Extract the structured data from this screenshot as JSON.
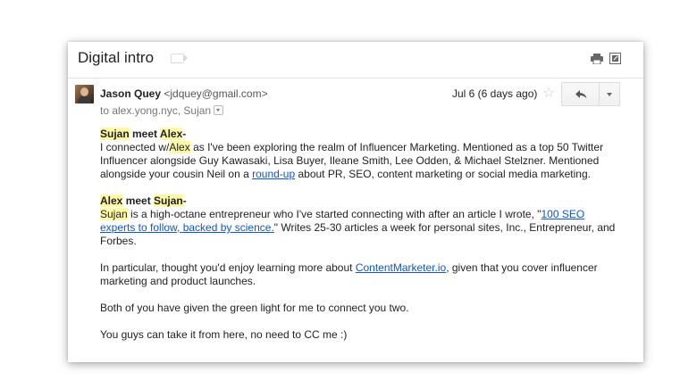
{
  "email": {
    "subject": "Digital intro",
    "sender_name": "Jason Quey",
    "sender_email": "<jdquey@gmail.com>",
    "to_line": "to alex.yong.nyc, Sujan",
    "date": "Jul 6 (6 days ago)",
    "icons": [
      "label-icon",
      "print-icon",
      "popout-icon",
      "avatar",
      "star-icon",
      "reply-icon",
      "more-actions-icon",
      "expand-recipients-icon"
    ]
  },
  "body": {
    "p1": {
      "greet_a": "Sujan",
      "greet_mid": " meet ",
      "greet_b": "Alex",
      "greet_end": "-",
      "t1": "I connected w/",
      "name": "Alex",
      "t2": " as I've been exploring the realm of Influencer Marketing. Mentioned as a top 50 Twitter Influencer alongside Guy Kawasaki, Lisa Buyer, Ileane Smith, Lee Odden, & Michael Stelzner. Mentioned alongside your cousin Neil on a ",
      "link": "round-up",
      "t3": " about PR, SEO, content marketing or social media marketing."
    },
    "p2": {
      "greet_a": "Alex",
      "greet_mid": " meet ",
      "greet_b": "Sujan",
      "greet_end": "-",
      "name": "Sujan",
      "t1": " is a high-octane entrepreneur who I've started connecting with after an article I wrote, \"",
      "link": "100 SEO experts to follow, backed by science.",
      "t2": "\" Writes 25-30 articles a week for personal sites, Inc., Entrepreneur, and Forbes."
    },
    "p3": {
      "t1": "In particular, thought you'd enjoy learning more about ",
      "link": "ContentMarketer.io",
      "t2": ", given that you cover influencer marketing and product launches."
    },
    "p4": "Both of you have given the green light for me to connect you two.",
    "p5": "You guys can take it from here, no need to CC me :)"
  },
  "colors": {
    "highlight": "#fff9a7",
    "link": "#1155cc"
  }
}
